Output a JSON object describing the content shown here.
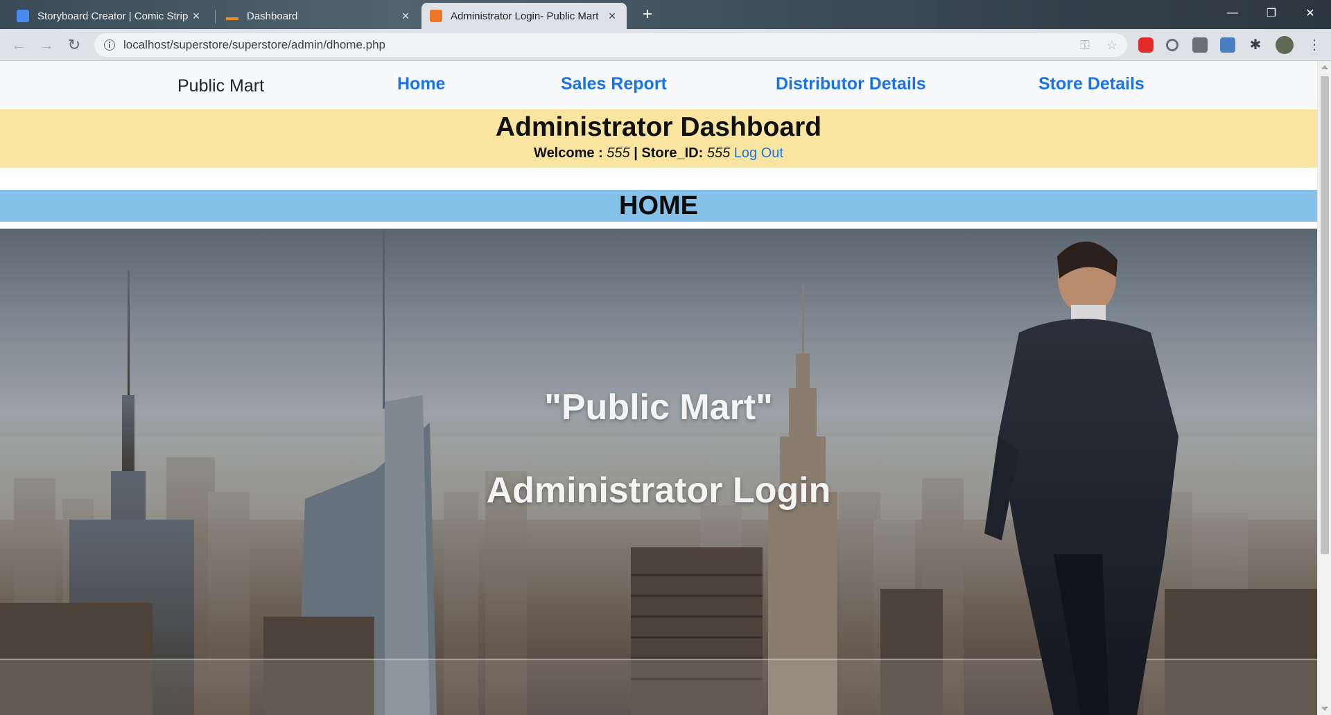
{
  "browser": {
    "tabs": [
      {
        "title": "Storyboard Creator | Comic Strip",
        "favicon_color": "#4a8cf0",
        "active": false
      },
      {
        "title": "Dashboard",
        "favicon_color": "#f08a24",
        "active": false
      },
      {
        "title": "Administrator Login- Public Mart",
        "favicon_color": "#f0762a",
        "active": true
      }
    ],
    "url": "localhost/superstore/superstore/admin/dhome.php"
  },
  "nav": {
    "brand": "Public Mart",
    "links": [
      "Home",
      "Sales Report",
      "Distributor Details",
      "Store Details"
    ]
  },
  "header": {
    "title": "Administrator Dashboard",
    "welcome_label": "Welcome :",
    "user": "555",
    "store_label": "| Store_ID:",
    "store_id": "555",
    "logout": "Log Out"
  },
  "section": {
    "title": "HOME"
  },
  "hero": {
    "quote": "\"Public Mart\"",
    "subtitle": "Administrator Login"
  },
  "colors": {
    "accent_link": "#1a73e8",
    "header_bg": "#fae5a0",
    "section_bg": "#86c1e9"
  }
}
